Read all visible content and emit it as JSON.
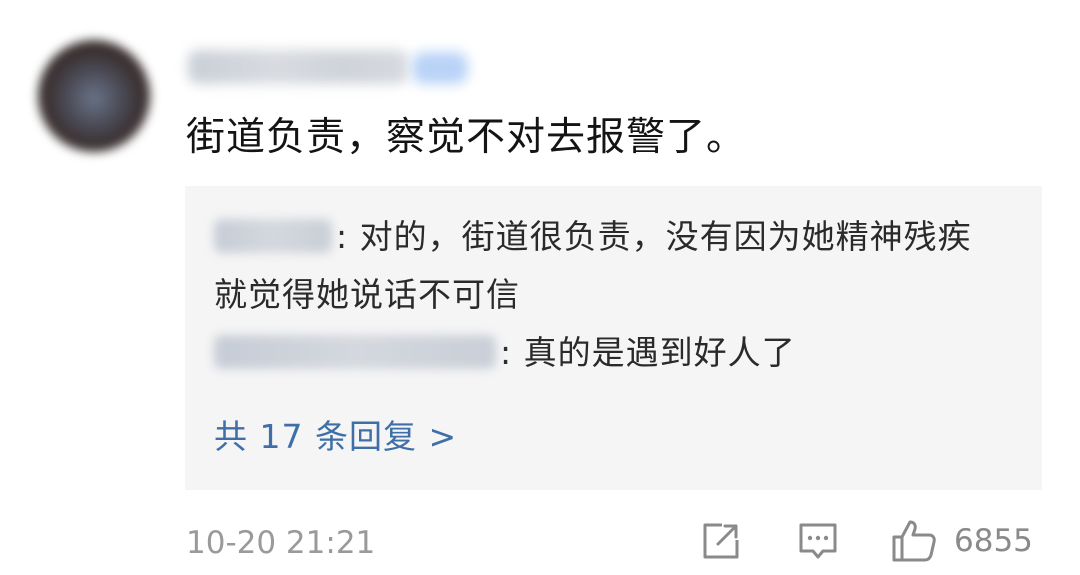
{
  "comment": {
    "avatar_icon": "user-avatar-blurred",
    "text": "街道负责，察觉不对去报警了。"
  },
  "replies": [
    {
      "text": ": 对的，街道很负责，没有因为她精神残疾就觉得她说话不可信"
    },
    {
      "text": ": 真的是遇到好人了"
    }
  ],
  "more_replies_label": "共 17 条回复 >",
  "footer": {
    "timestamp": "10-20 21:21",
    "share_icon": "share-icon",
    "comment_icon": "comment-icon",
    "like_icon": "thumbs-up-icon",
    "like_count": "6855"
  },
  "colors": {
    "link": "#3f6fa6",
    "reply_bg": "#f5f5f5",
    "text": "#141414",
    "muted": "#9a9a9a"
  }
}
